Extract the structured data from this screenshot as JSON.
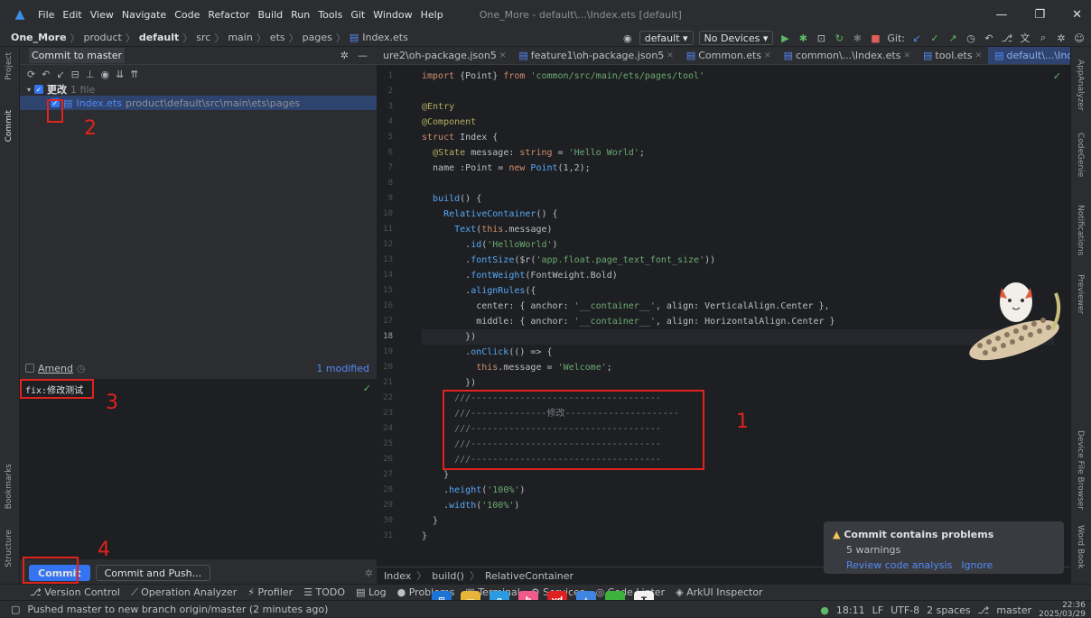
{
  "window": {
    "menu": [
      "File",
      "Edit",
      "View",
      "Navigate",
      "Code",
      "Refactor",
      "Build",
      "Run",
      "Tools",
      "Git",
      "Window",
      "Help"
    ],
    "title": "One_More - default\\...\\Index.ets [default]"
  },
  "nav": {
    "crumbs": [
      "One_More",
      "product",
      "default",
      "src",
      "main",
      "ets",
      "pages",
      "Index.ets"
    ],
    "device_config": "default",
    "devices": "No Devices",
    "git_label": "Git:"
  },
  "commit_panel": {
    "header": "Commit to master",
    "changes_label": "更改",
    "changes_count": "1 file",
    "file_name": "Index.ets",
    "file_path": "product\\default\\src\\main\\ets\\pages",
    "amend_label": "Amend",
    "modified": "1 modified",
    "message": "fix:修改测试",
    "commit_label": "Commit",
    "commit_push_label": "Commit and Push..."
  },
  "tabs": [
    {
      "label": "ure2\\oh-package.json5"
    },
    {
      "label": "feature1\\oh-package.json5"
    },
    {
      "label": "Common.ets"
    },
    {
      "label": "common\\...\\Index.ets"
    },
    {
      "label": "tool.ets"
    },
    {
      "label": "default\\...\\Index.ets",
      "active": true
    }
  ],
  "code": {
    "current_line": 18,
    "lines": [
      "import {Point} from 'common/src/main/ets/pages/tool'",
      "",
      "@Entry",
      "@Component",
      "struct Index {",
      "  @State message: string = 'Hello World';",
      "  name :Point = new Point(1,2);",
      "",
      "  build() {",
      "    RelativeContainer() {",
      "      Text(this.message)",
      "        .id('HelloWorld')",
      "        .fontSize($r('app.float.page_text_font_size'))",
      "        .fontWeight(FontWeight.Bold)",
      "        .alignRules({",
      "          center: { anchor: '__container__', align: VerticalAlign.Center },",
      "          middle: { anchor: '__container__', align: HorizontalAlign.Center }",
      "        })",
      "        .onClick(() => {",
      "          this.message = 'Welcome';",
      "        })",
      "      ///-----------------------------------",
      "      ///--------------修改---------------------",
      "      ///-----------------------------------",
      "      ///-----------------------------------",
      "      ///-----------------------------------",
      "    }",
      "    .height('100%')",
      "    .width('100%')",
      "  }",
      "}"
    ]
  },
  "editor_breadcrumb": [
    "Index",
    "build()",
    "RelativeContainer"
  ],
  "annotations": {
    "n1": "1",
    "n2": "2",
    "n3": "3",
    "n4": "4"
  },
  "notification": {
    "title": "Commit contains problems",
    "subtitle": "5 warnings",
    "review": "Review code analysis",
    "ignore": "Ignore"
  },
  "tool_windows": [
    "Version Control",
    "Operation Analyzer",
    "Profiler",
    "TODO",
    "Log",
    "Problems",
    "Terminal",
    "Services",
    "Code Linter",
    "ArkUI Inspector"
  ],
  "left_strip": [
    "Project",
    "Commit",
    "Bookmarks",
    "Structure"
  ],
  "right_strip": [
    "AppAnalyzer",
    "CodeGenie",
    "Notifications",
    "Previewer",
    "Device File Browser",
    "Word Book"
  ],
  "status": {
    "message": "Pushed master to new branch origin/master (2 minutes ago)",
    "position": "18:11",
    "line_sep": "LF",
    "encoding": "UTF-8",
    "indent": "2 spaces",
    "branch": "master",
    "time": "22:36",
    "date": "2025/03/29"
  },
  "taskbar": [
    "windows-icon",
    "explorer-icon",
    "edge-icon",
    "bilibili-icon",
    "youdao-icon",
    "devstudio-icon",
    "wechat-icon",
    "typora-icon"
  ],
  "colors": {
    "accent": "#3574f0",
    "annotation": "#e0231c",
    "active_tab": "#2e436e"
  }
}
